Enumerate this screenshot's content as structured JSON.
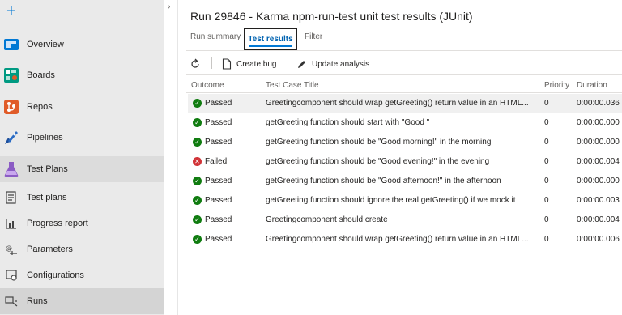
{
  "sidebar": {
    "add_label": "+",
    "items": [
      {
        "label": "Overview",
        "icon": "overview-icon",
        "color": "#0078d4"
      },
      {
        "label": "Boards",
        "icon": "boards-icon",
        "color": "#009a82"
      },
      {
        "label": "Repos",
        "icon": "repos-icon",
        "color": "#e05b28"
      },
      {
        "label": "Pipelines",
        "icon": "pipelines-icon",
        "color": "#2b6cc4"
      },
      {
        "label": "Test Plans",
        "icon": "test-plans-icon",
        "color": "#8b5cc4"
      }
    ],
    "sub_items": [
      {
        "label": "Test plans",
        "icon": "test-plans-list-icon"
      },
      {
        "label": "Progress report",
        "icon": "progress-report-icon"
      },
      {
        "label": "Parameters",
        "icon": "parameters-icon"
      },
      {
        "label": "Configurations",
        "icon": "configurations-icon"
      },
      {
        "label": "Runs",
        "icon": "runs-icon"
      }
    ]
  },
  "header": {
    "title": "Run 29846 - Karma npm-run-test unit test results (JUnit)",
    "tabs": [
      {
        "label": "Run summary"
      },
      {
        "label": "Test results"
      },
      {
        "label": "Filter"
      }
    ]
  },
  "toolbar": {
    "refresh_icon": "refresh-icon",
    "create_bug_label": "Create bug",
    "update_analysis_label": "Update analysis"
  },
  "table": {
    "columns": [
      "Outcome",
      "Test Case Title",
      "Priority",
      "Duration"
    ],
    "rows": [
      {
        "outcome": "Passed",
        "status": "passed",
        "title": "Greetingcomponent should wrap getGreeting() return value in an HTML...",
        "priority": "0",
        "duration": "0:00:00.036"
      },
      {
        "outcome": "Passed",
        "status": "passed",
        "title": "getGreeting function should start with \"Good \"",
        "priority": "0",
        "duration": "0:00:00.000"
      },
      {
        "outcome": "Passed",
        "status": "passed",
        "title": "getGreeting function should be \"Good morning!\" in the morning",
        "priority": "0",
        "duration": "0:00:00.000"
      },
      {
        "outcome": "Failed",
        "status": "failed",
        "title": "getGreeting function should be \"Good evening!\" in the evening",
        "priority": "0",
        "duration": "0:00:00.004"
      },
      {
        "outcome": "Passed",
        "status": "passed",
        "title": "getGreeting function should be \"Good afternoon!\" in the afternoon",
        "priority": "0",
        "duration": "0:00:00.000"
      },
      {
        "outcome": "Passed",
        "status": "passed",
        "title": "getGreeting function should ignore the real getGreeting() if we mock it",
        "priority": "0",
        "duration": "0:00:00.003"
      },
      {
        "outcome": "Passed",
        "status": "passed",
        "title": "Greetingcomponent should create",
        "priority": "0",
        "duration": "0:00:00.004"
      },
      {
        "outcome": "Passed",
        "status": "passed",
        "title": "Greetingcomponent should wrap getGreeting() return value in an HTML...",
        "priority": "0",
        "duration": "0:00:00.006"
      }
    ]
  },
  "colors": {
    "passed": "#107c10",
    "failed": "#d13438",
    "accent": "#0078d4"
  }
}
